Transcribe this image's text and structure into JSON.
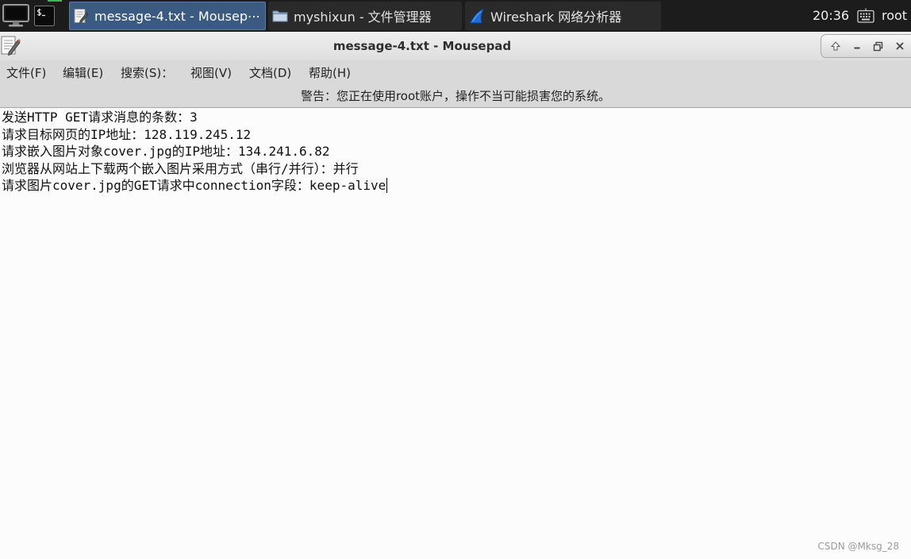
{
  "colors": {
    "taskbar_bg": "#1c1c1c",
    "task_bg": "#2a2a2a",
    "active_task_bg": "#3a5a82",
    "chrome_bg": "#d9d9d9",
    "editor_bg": "#fcfcfc",
    "wireshark_fin": "#1f6ed8"
  },
  "taskbar": {
    "launchers": [
      {
        "icon": "show-desktop-icon"
      },
      {
        "icon": "terminal-icon"
      }
    ],
    "tasks": [
      {
        "label": "message-4.txt - Mousep⋯",
        "icon": "text-editor-icon",
        "active": true
      },
      {
        "label": "myshixun - 文件管理器",
        "icon": "folder-icon",
        "active": false
      },
      {
        "label": "Wireshark 网络分析器",
        "icon": "wireshark-fin-icon",
        "active": false
      }
    ],
    "clock": "20:36",
    "keyboard_icon": "keyboard-icon",
    "user": "root"
  },
  "window": {
    "icon": "mousepad-icon",
    "title": "message-4.txt - Mousepad",
    "controls": [
      {
        "icon": "shade-up-icon"
      },
      {
        "icon": "minimize-icon"
      },
      {
        "icon": "restore-icon"
      },
      {
        "icon": "close-icon"
      }
    ],
    "menu": [
      {
        "label": "文件(F)"
      },
      {
        "label": "编辑(E)"
      },
      {
        "label": "搜索(S)："
      },
      {
        "label": "视图(V)"
      },
      {
        "label": "文档(D)"
      },
      {
        "label": "帮助(H)"
      }
    ],
    "warning": "警告：您正在使用root账户，操作不当可能损害您的系统。"
  },
  "editor": {
    "lines": [
      "发送HTTP GET请求消息的条数：3",
      "请求目标网页的IP地址：128.119.245.12",
      "请求嵌入图片对象cover.jpg的IP地址：134.241.6.82",
      "浏览器从网站上下载两个嵌入图片采用方式（串行/并行）：并行",
      "请求图片cover.jpg的GET请求中connection字段：keep-alive"
    ]
  },
  "watermark": "CSDN @Mksg_28"
}
